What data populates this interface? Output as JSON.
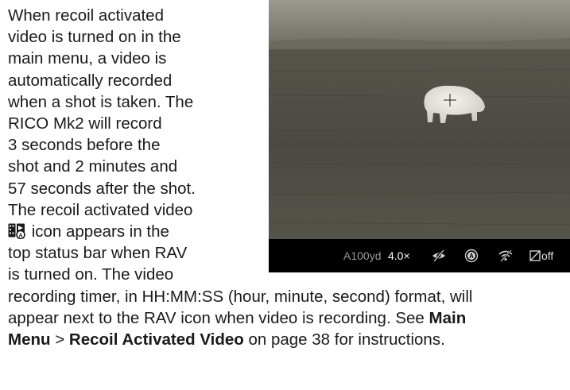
{
  "paragraph": {
    "line1": "When recoil activated",
    "line2": "video is turned on in the",
    "line3": "main menu, a video is",
    "line4": "automatically recorded",
    "line5": "when a shot is taken. The",
    "line6": "RICO Mk2 will record",
    "line7": "3 seconds before the",
    "line8": "shot and 2 minutes and",
    "line9": "57 seconds after the shot.",
    "line10": "The recoil activated video",
    "line11_text": " icon appears in the",
    "line12": "top status bar when RAV",
    "line13": "is turned on. The video",
    "line14": "recording timer, in HH:MM:SS (hour, minute, second) format, will",
    "line15_pre": "appear next to the RAV icon when video is recording. See ",
    "line15_bold": "Main",
    "line16_bold1": "Menu",
    "line16_sep": " > ",
    "line16_bold2": "Recoil Activated Video",
    "line16_post": " on page 38 for instructions."
  },
  "inline_icon": "recoil-activated-video-icon",
  "thermal_view": {
    "status_bar": {
      "range": "A100yd",
      "zoom": "4.0×",
      "icons": [
        "eye-off-icon",
        "auto-mode-icon",
        "wifi-off-icon",
        "pip-icon"
      ],
      "pip_state": "off"
    }
  }
}
